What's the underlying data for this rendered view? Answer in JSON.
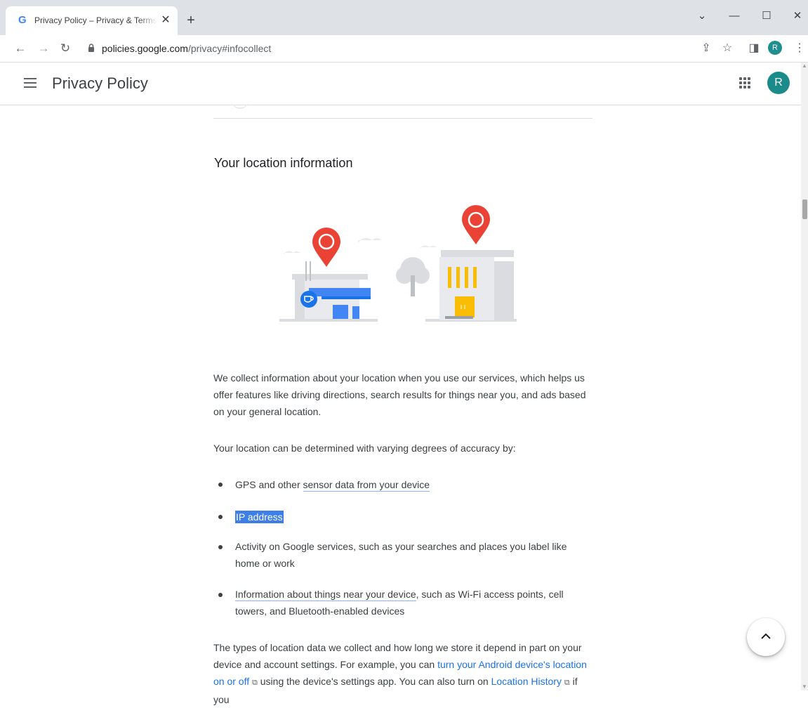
{
  "browser": {
    "tab_title": "Privacy Policy – Privacy & Terms – Google",
    "tab_close": "✕",
    "new_tab": "+",
    "url_host": "policies.google.com",
    "url_path": "/privacy#infocollect",
    "profile_initial": "R",
    "window_controls": {
      "dropdown": "⌄",
      "minimize": "—",
      "maximize": "☐",
      "close": "✕"
    }
  },
  "header": {
    "title": "Privacy Policy",
    "avatar_initial": "R"
  },
  "section": {
    "heading": "Your location information",
    "intro": "We collect information about your location when you use our services, which helps us offer features like driving directions, search results for things near you, and ads based on your general location.",
    "accuracy_lead": "Your location can be determined with varying degrees of accuracy by:",
    "bullets": [
      {
        "pre": "GPS and other ",
        "link": "sensor data from your device",
        "post": ""
      },
      {
        "selected": "IP address"
      },
      {
        "text": "Activity on Google services, such as your searches and places you label like home or work"
      },
      {
        "link": "Information about things near your device",
        "post": ", such as Wi-Fi access points, cell towers, and Bluetooth-enabled devices"
      }
    ],
    "closing": {
      "part1": "The types of location data we collect and how long we store it depend in part on your device and account settings. For example, you can ",
      "link1": "turn your Android device's location on or off",
      "part2": " using the device's settings app. You can also turn on ",
      "link2": "Location History",
      "part3": " if you"
    }
  },
  "icons": {
    "external": "⧉"
  },
  "colors": {
    "pin_red": "#ea4335",
    "accent_blue": "#1a73e8",
    "building_yellow": "#fbbc04",
    "avatar_teal": "#1a8a8a",
    "selection_blue": "#3d7fe6"
  }
}
